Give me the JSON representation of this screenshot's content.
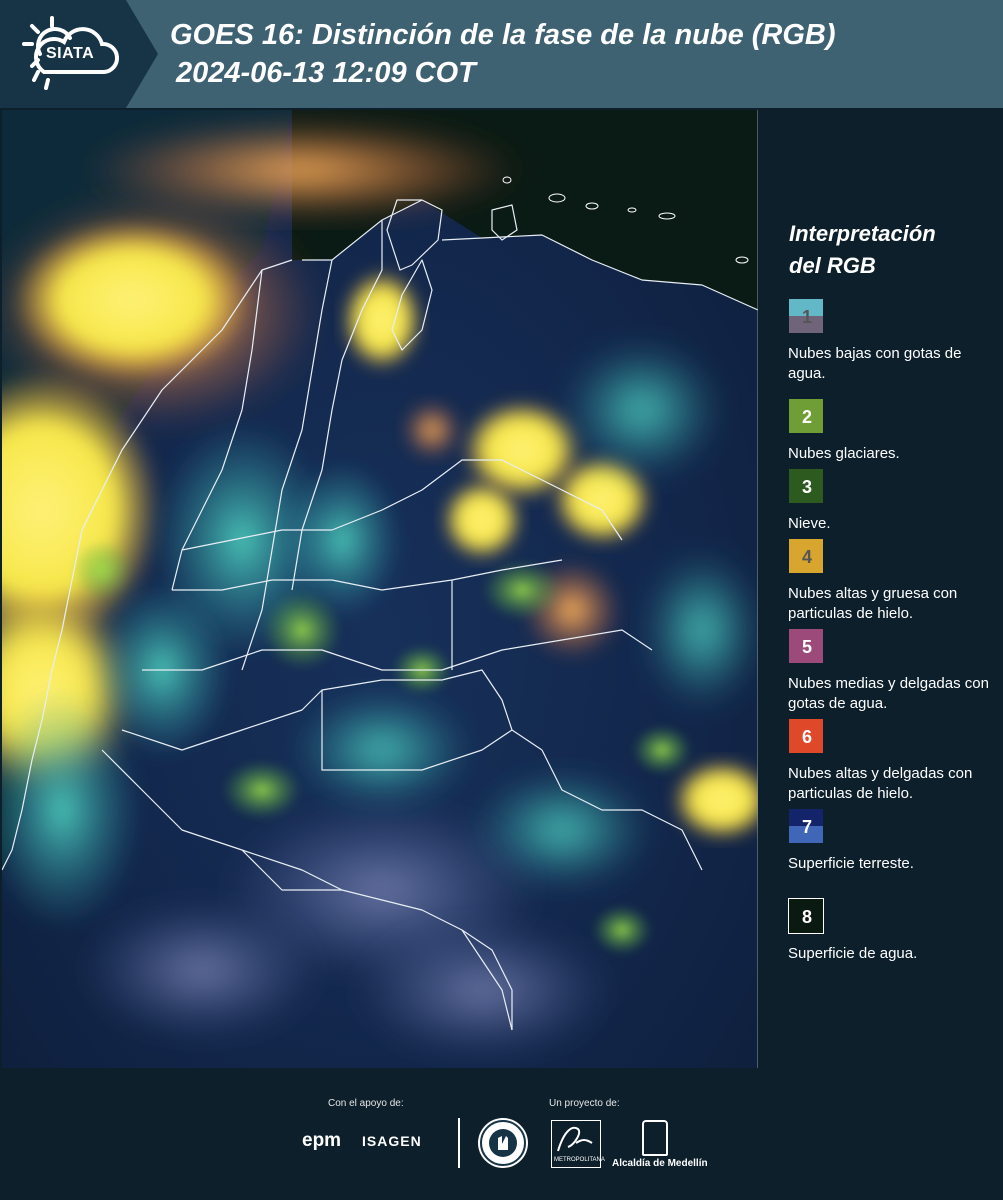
{
  "header": {
    "logo_text": "SIATA",
    "title": "GOES 16: Distinción de la fase de la nube (RGB)",
    "subtitle": "2024-06-13 12:09 COT"
  },
  "map": {
    "description_icon": "goes16-rgb-satellite-map",
    "colors": {
      "ocean": "#0c1a2e",
      "land": "#17305a",
      "cloud_yellow": "#f5e85a",
      "cloud_cyan": "#3fc9b8",
      "border": "#e8eef5"
    }
  },
  "legend": {
    "title_line1": "Interpretación",
    "title_line2": "del RGB",
    "items": [
      {
        "num": "1",
        "label": "Nubes bajas con gotas de agua.",
        "color_top": "#62b8c6",
        "color_bottom": "#6f647a",
        "num_color": "#555555"
      },
      {
        "num": "2",
        "label": "Nubes glaciares.",
        "color_top": "#6f9e36",
        "color_bottom": "#6f9e36",
        "num_color": "#ffffff"
      },
      {
        "num": "3",
        "label": "Nieve.",
        "color_top": "#2d5a1e",
        "color_bottom": "#2d5a1e",
        "num_color": "#ffffff"
      },
      {
        "num": "4",
        "label": "Nubes altas y gruesa con particulas de hielo.",
        "color_top": "#d8a62e",
        "color_bottom": "#d8a62e",
        "num_color": "#555555"
      },
      {
        "num": "5",
        "label": "Nubes medias y delgadas con gotas de agua.",
        "color_top": "#9c4a7a",
        "color_bottom": "#9c4a7a",
        "num_color": "#ffffff"
      },
      {
        "num": "6",
        "label": "Nubes altas y delgadas con particulas de hielo.",
        "color_top": "#e0482a",
        "color_bottom": "#e0482a",
        "num_color": "#ffffff"
      },
      {
        "num": "7",
        "label": "Superficie terreste.",
        "color_top": "#14246a",
        "color_bottom": "#4066b8",
        "num_color": "#ffffff"
      },
      {
        "num": "8",
        "label": "Superficie de agua.",
        "color_top": "#0a1a10",
        "color_bottom": "#0a1a10",
        "num_color": "#ffffff",
        "outline": "#ffffff"
      }
    ]
  },
  "footer": {
    "support_label": "Con el apoyo de:",
    "project_label": "Un proyecto de:",
    "epm": "epm",
    "isagen": "ISAGEN",
    "area_text": "METROPOLITANA",
    "alcaldia": "Alcaldía de Medellín"
  }
}
